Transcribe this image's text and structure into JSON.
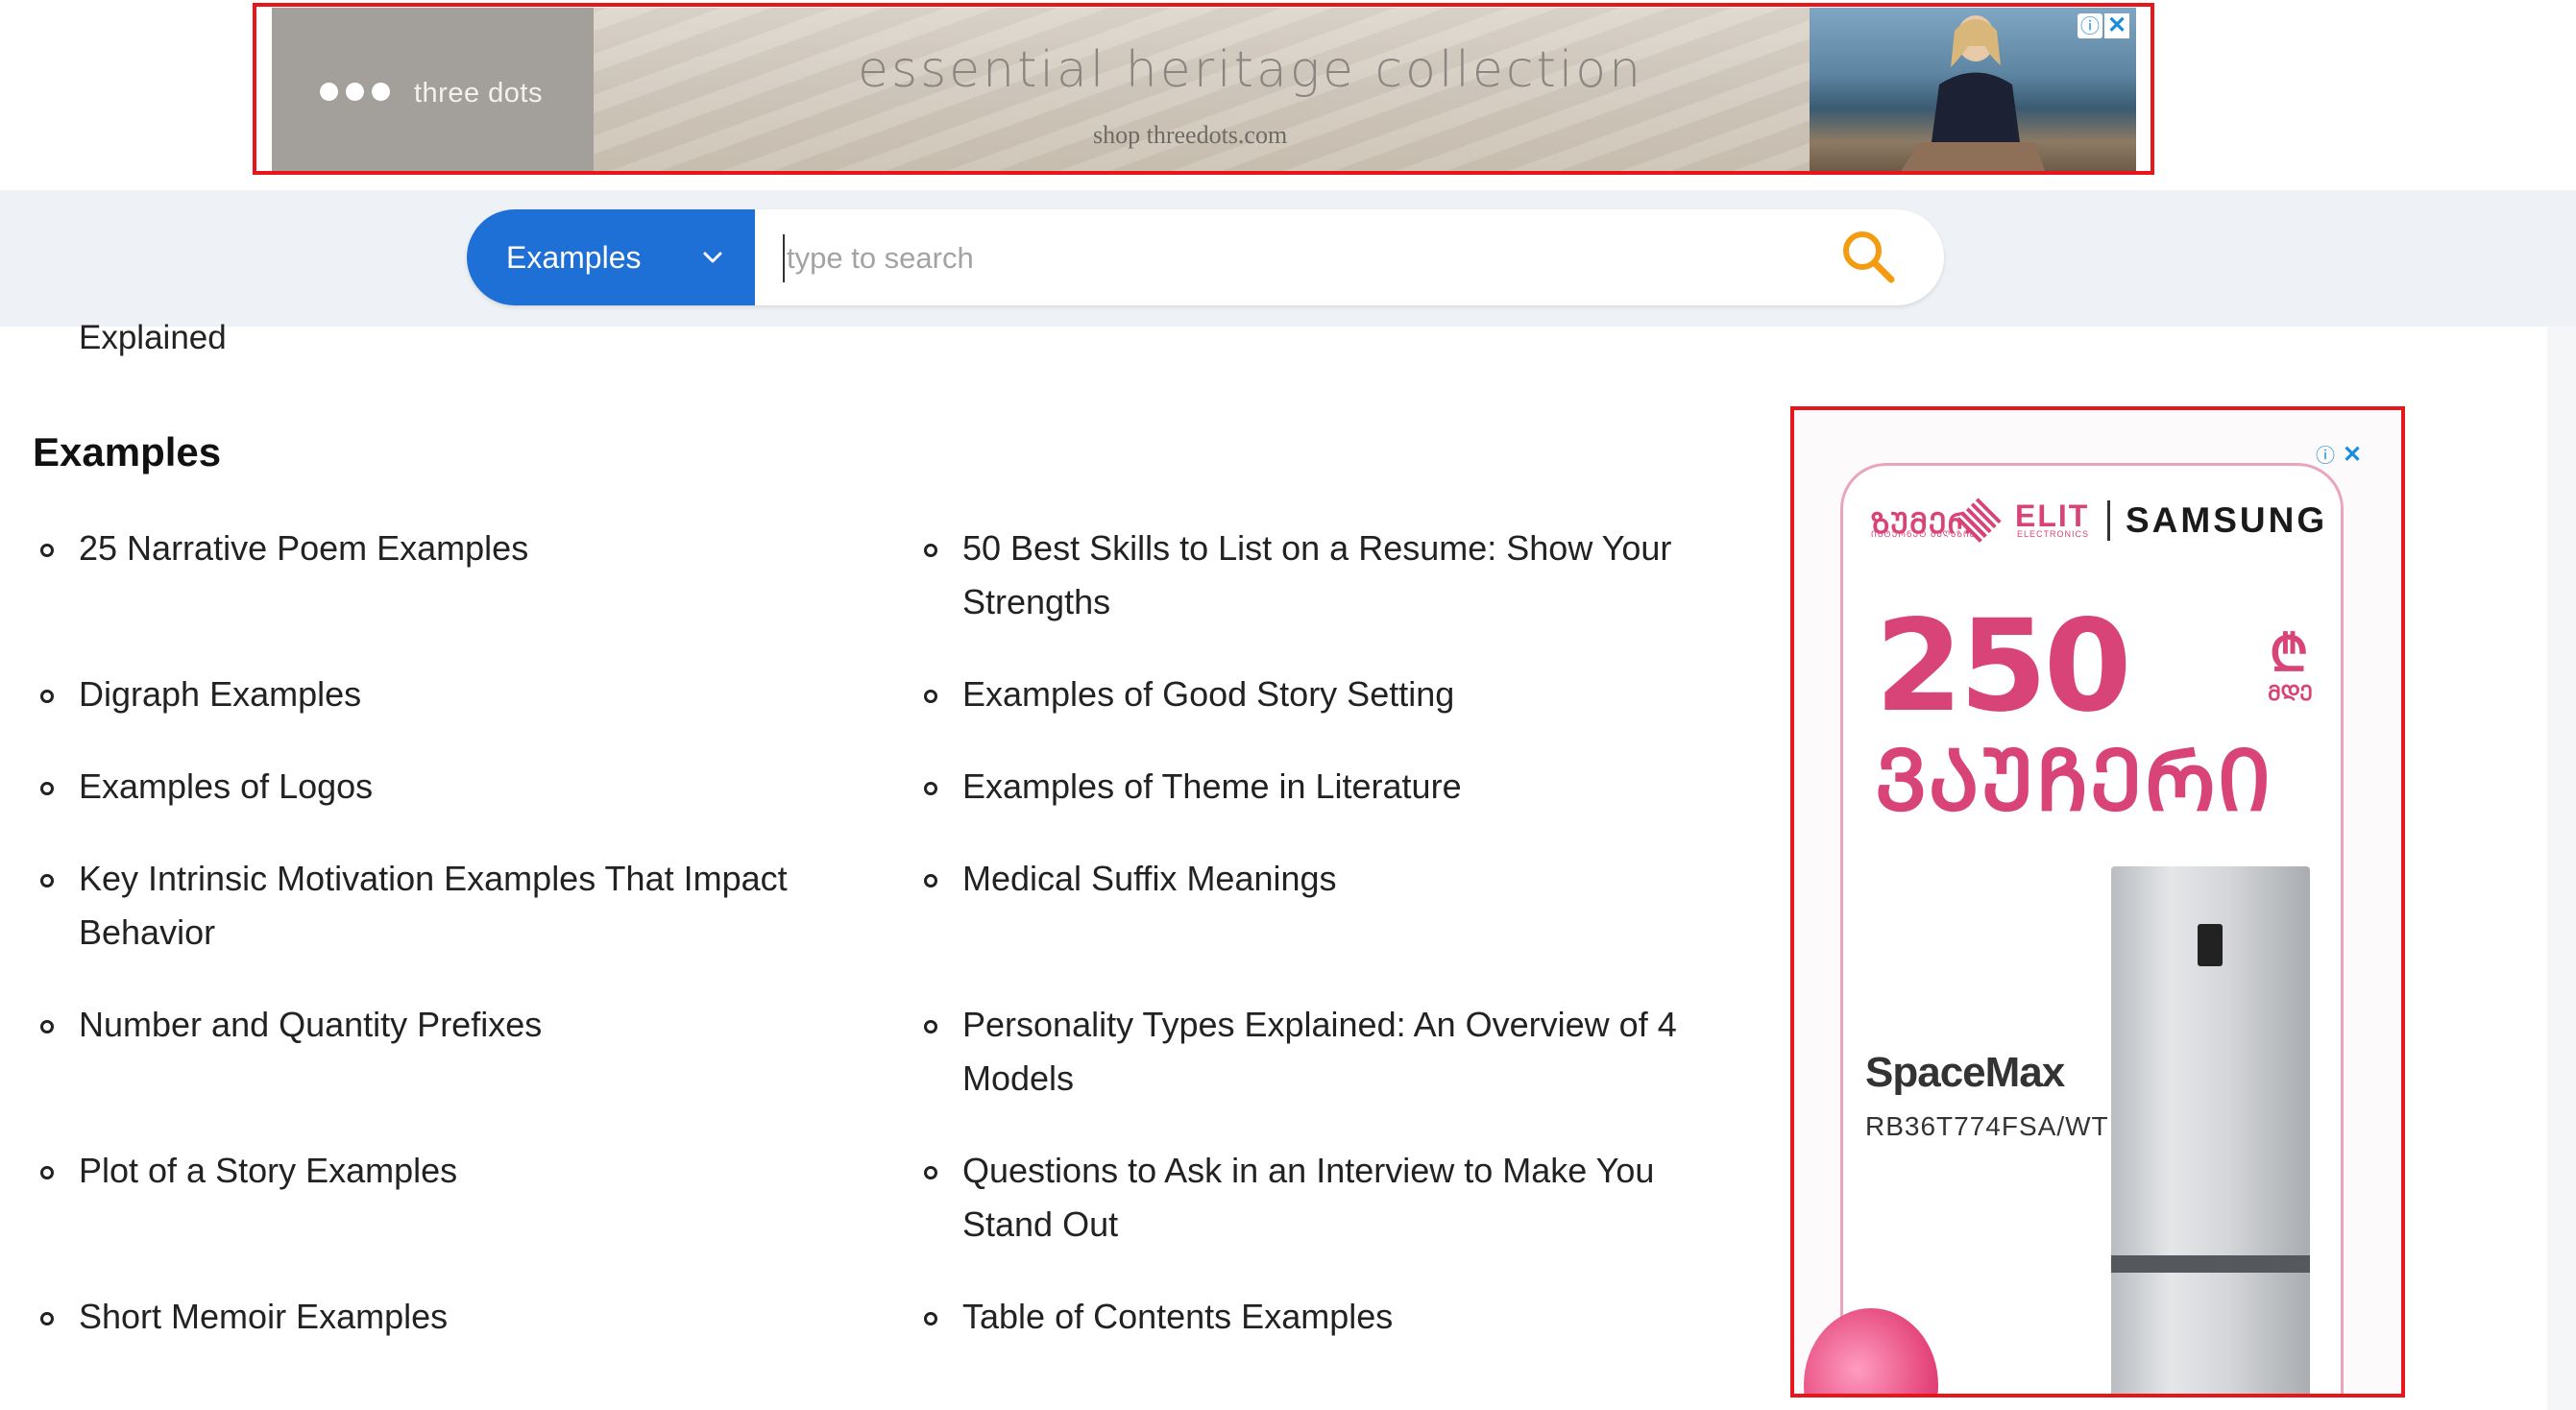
{
  "top_ad": {
    "brand": "three dots",
    "headline": "essential heritage collection",
    "subline": "shop threedots.com",
    "info_icon": "info-icon",
    "close_icon": "close-icon"
  },
  "search": {
    "category_label": "Examples",
    "placeholder": "type to search",
    "value": "",
    "icon": "search-icon"
  },
  "main": {
    "truncated_text": "Explained",
    "section_title": "Examples",
    "left_items": [
      "25 Narrative Poem Examples",
      "Digraph Examples",
      "Examples of Logos",
      "Key Intrinsic Motivation Examples That Impact Behavior",
      "Number and Quantity Prefixes",
      "Plot of a Story Examples",
      "Short Memoir Examples"
    ],
    "right_items": [
      "50 Best Skills to List on a Resume: Show Your Strengths",
      "Examples of Good Story Setting",
      "Examples of Theme in Literature",
      "Medical Suffix Meanings",
      "Personality Types Explained: An Overview of 4 Models",
      "Questions to Ask in an Interview to Make You Stand Out",
      "Table of Contents Examples"
    ]
  },
  "side_ad": {
    "logo_zoomer": "ᲖᲣᲛᲔᲠᲘ",
    "logo_zoomer_sub": "ᲘᲜᲢᲔᲠᲜᲔᲢ ᲛᲐᲦᲐᲖᲘᲐ",
    "logo_elit": "ELIT",
    "logo_elit_sub": "ELECTRONICS",
    "logo_samsung": "SAMSUNG",
    "amount": "250",
    "currency": "₾",
    "currency_sub": "ᲛᲓᲔ",
    "voucher": "ᲕᲐᲣᲩᲔᲠᲘ",
    "product_line": "SpaceMax",
    "model": "RB36T774FSA/WT",
    "info_icon": "info-icon",
    "close_icon": "close-icon"
  },
  "colors": {
    "ad_frame": "#e8161b",
    "search_button": "#1e6fd6",
    "search_icon": "#f39c12",
    "ad_pink": "#d94478"
  }
}
